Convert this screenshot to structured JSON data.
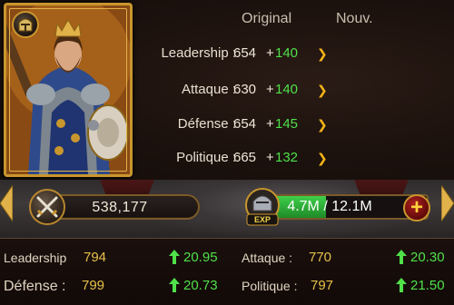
{
  "header": {
    "original_label": "Original",
    "new_label": "Nouv."
  },
  "stats": [
    {
      "label": "Leadership :",
      "base": "654",
      "bonus": "140"
    },
    {
      "label": "Attaque :",
      "base": "630",
      "bonus": "140"
    },
    {
      "label": "Défense :",
      "base": "654",
      "bonus": "145"
    },
    {
      "label": "Politique :",
      "base": "665",
      "bonus": "132"
    }
  ],
  "plus_sign": "+",
  "power": {
    "value": "538,177",
    "icon": "crossed-swords-icon"
  },
  "experience": {
    "badge": "EXP",
    "value": "4.7M / 12.1M",
    "progress_fraction": 0.39
  },
  "add_button": {
    "label": "+"
  },
  "summary": [
    {
      "label": "Leadership",
      "value": "794",
      "gain": "20.95"
    },
    {
      "label": "Attaque :",
      "value": "770",
      "gain": "20.30"
    },
    {
      "label": "Défense :",
      "value": "799",
      "gain": "20.73"
    },
    {
      "label": "Politique :",
      "value": "797",
      "gain": "21.50"
    }
  ],
  "colors": {
    "bonus_green": "#4fe04a",
    "value_gold": "#e6c14a",
    "frame_gold": "#c9962e",
    "exp_green": "#3fcf4a"
  }
}
